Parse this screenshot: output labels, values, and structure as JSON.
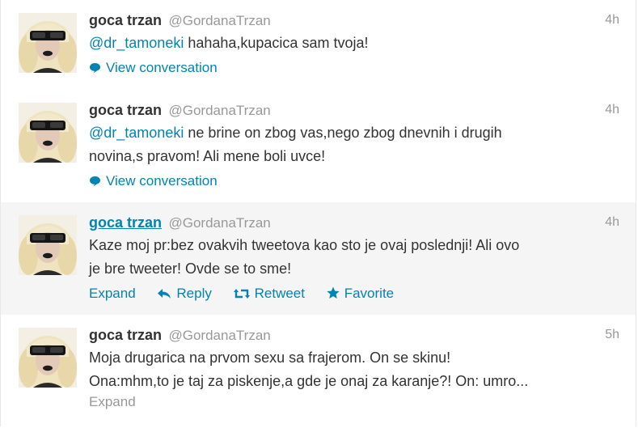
{
  "tweets": [
    {
      "fullname": "goca trzan",
      "screenname": "@GordanaTrzan",
      "time": "4h",
      "mention": "@dr_tamoneki",
      "line1": " hahaha,kupacica sam tvoja!",
      "line2": "",
      "footer": "View conversation"
    },
    {
      "fullname": "goca trzan",
      "screenname": "@GordanaTrzan",
      "time": "4h",
      "mention": "@dr_tamoneki",
      "line1": " ne brine on zbog vas,nego zbog dnevnih i drugih",
      "line2": "novina,s pravom! Ali mene boli uvce!",
      "footer": "View conversation"
    },
    {
      "fullname": "goca trzan",
      "screenname": "@GordanaTrzan",
      "time": "4h",
      "line1": "Kaze moj pr:bez ovakvih tweetova kao sto je ovaj poslednji! Ali ovo",
      "line2": "je bre tweeter! Ovde se to sme!",
      "actions": {
        "expand": "Expand",
        "reply": "Reply",
        "retweet": "Retweet",
        "favorite": "Favorite"
      }
    },
    {
      "fullname": "goca trzan",
      "screenname": "@GordanaTrzan",
      "time": "5h",
      "line1": "Moja drugarica na prvom sexu sa frajerom. On se skinu!",
      "line2": "Ona:mhm,to je taj za piskenje,a gde je onaj za karanje?! On: umro...",
      "footer": "Expand"
    }
  ],
  "colors": {
    "link": "#0084b4",
    "muted": "#999999",
    "text": "#333333",
    "hover_bg": "#f5f5f5"
  }
}
